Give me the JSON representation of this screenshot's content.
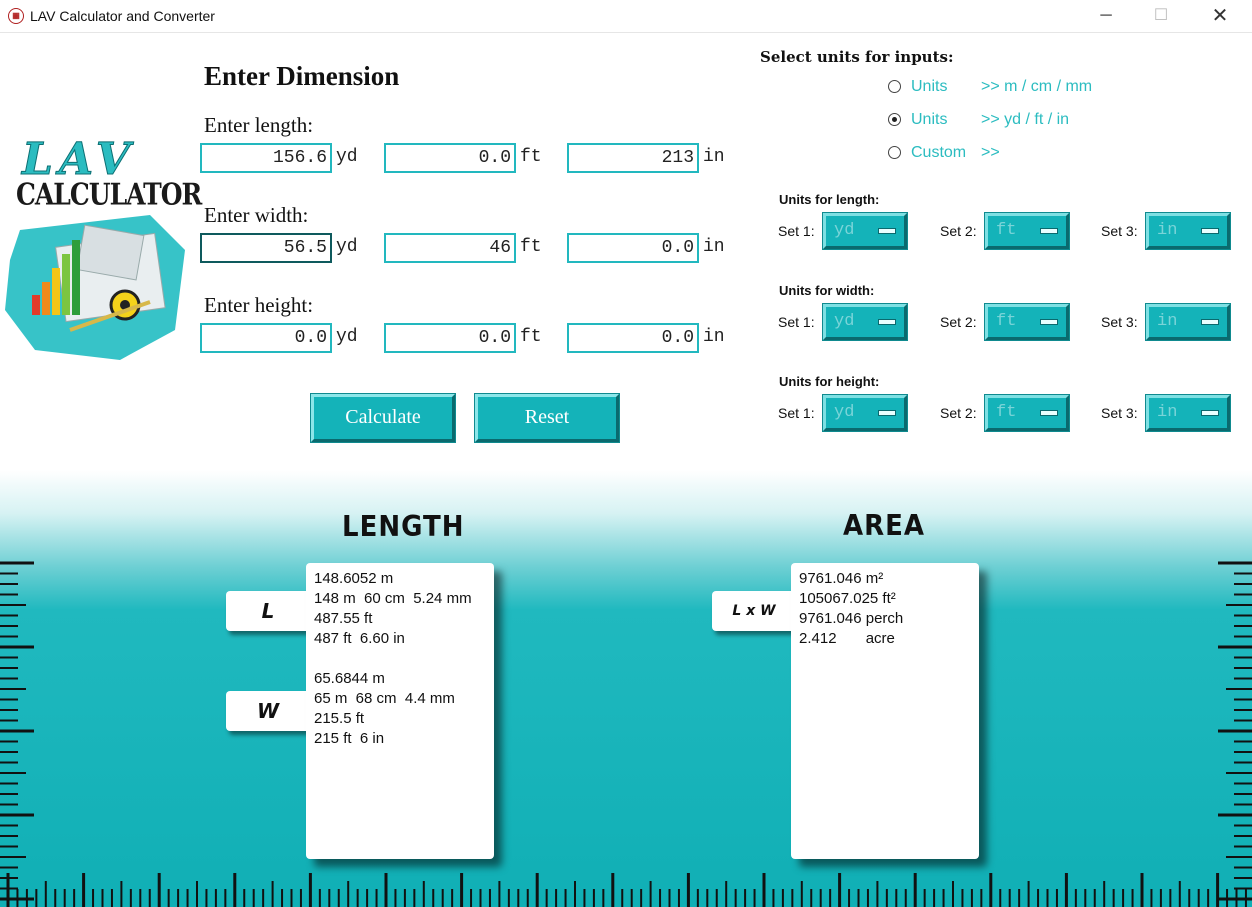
{
  "window": {
    "title": "LAV Calculator and Converter",
    "min_glyph": "─",
    "max_glyph": "☐",
    "close_glyph": "✕"
  },
  "logo": {
    "line1": "LAV",
    "line2": "CALCULATOR"
  },
  "input": {
    "section_title": "Enter Dimension",
    "length": {
      "label": "Enter length:",
      "values": [
        "156.6",
        "0.0",
        "213"
      ],
      "units": [
        "yd",
        "ft",
        "in"
      ]
    },
    "width": {
      "label": "Enter width:",
      "values": [
        "56.5",
        "46",
        "0.0"
      ],
      "units": [
        "yd",
        "ft",
        "in"
      ]
    },
    "height": {
      "label": "Enter height:",
      "values": [
        "0.0",
        "0.0",
        "0.0"
      ],
      "units": [
        "yd",
        "ft",
        "in"
      ]
    },
    "calculate_label": "Calculate",
    "reset_label": "Reset"
  },
  "unit_select": {
    "title": "Select units for inputs:",
    "options": [
      {
        "label": "Units",
        "desc": ">> m / cm / mm",
        "checked": false
      },
      {
        "label": "Units",
        "desc": ">> yd / ft / in",
        "checked": true
      },
      {
        "label": "Custom",
        "desc": ">>",
        "checked": false
      }
    ]
  },
  "unit_groups": [
    {
      "title": "Units for length:",
      "sets": [
        {
          "label": "Set 1:",
          "value": "yd"
        },
        {
          "label": "Set 2:",
          "value": "ft"
        },
        {
          "label": "Set 3:",
          "value": "in"
        }
      ]
    },
    {
      "title": "Units for width:",
      "sets": [
        {
          "label": "Set 1:",
          "value": "yd"
        },
        {
          "label": "Set 2:",
          "value": "ft"
        },
        {
          "label": "Set 3:",
          "value": "in"
        }
      ]
    },
    {
      "title": "Units for height:",
      "sets": [
        {
          "label": "Set 1:",
          "value": "yd"
        },
        {
          "label": "Set 2:",
          "value": "ft"
        },
        {
          "label": "Set 3:",
          "value": "in"
        }
      ]
    }
  ],
  "output": {
    "length_title": "LENGTH",
    "area_title": "AREA",
    "tag_l": "L",
    "tag_w": "W",
    "tag_lxw": "L x W",
    "length_lines": [
      "148.6052 m",
      "148 m  60 cm  5.24 mm",
      "487.55 ft",
      "487 ft  6.60 in",
      "",
      "65.6844 m",
      "65 m  68 cm  4.4 mm",
      "215.5 ft",
      "215 ft  6 in"
    ],
    "area_lines": [
      "9761.046 m²",
      "105067.025 ft²",
      "9761.046 perch",
      "2.412       acre"
    ]
  },
  "colors": {
    "accent": "#14b3b9",
    "accent_text": "#2bbcc0"
  }
}
